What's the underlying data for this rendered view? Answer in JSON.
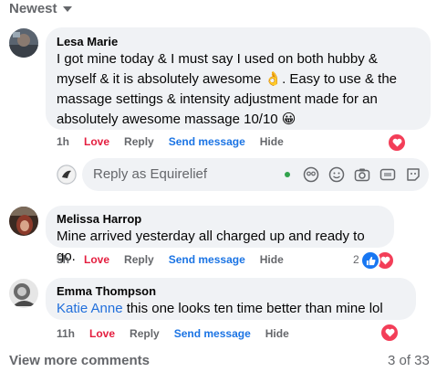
{
  "sort": {
    "label": "Newest"
  },
  "comments": [
    {
      "author": "Lesa Marie",
      "lines": [
        "I got mine today & I must say I used on both hubby &",
        "myself & it is absolutely awesome 👌. Easy to use & the",
        "massage settings & intensity adjustment made for an",
        "absolutely awesome massage 10/10 😀"
      ],
      "time": "1h",
      "love": "Love",
      "reply": "Reply",
      "send": "Send message",
      "hide": "Hide",
      "reactions": [
        "love"
      ]
    },
    {
      "author": "Melissa Harrop",
      "text": "Mine arrived yesterday all charged up and ready to go.",
      "time": "5h",
      "love": "Love",
      "reply": "Reply",
      "send": "Send message",
      "hide": "Hide",
      "reaction_count": "2",
      "reactions": [
        "like",
        "love"
      ]
    },
    {
      "author": "Emma Thompson",
      "mention": "Katie Anne",
      "text": " this one looks ten time better than mine lol",
      "time": "11h",
      "love": "Love",
      "reply": "Reply",
      "send": "Send message",
      "hide": "Hide",
      "reactions": [
        "love"
      ]
    }
  ],
  "reply_box": {
    "placeholder": "Reply as Equirelief"
  },
  "footer": {
    "view_more": "View more comments",
    "pager": "3 of 33"
  },
  "colors": {
    "accent": "#1b74e4",
    "love": "#e41e3f",
    "bubble": "#f0f2f5"
  }
}
